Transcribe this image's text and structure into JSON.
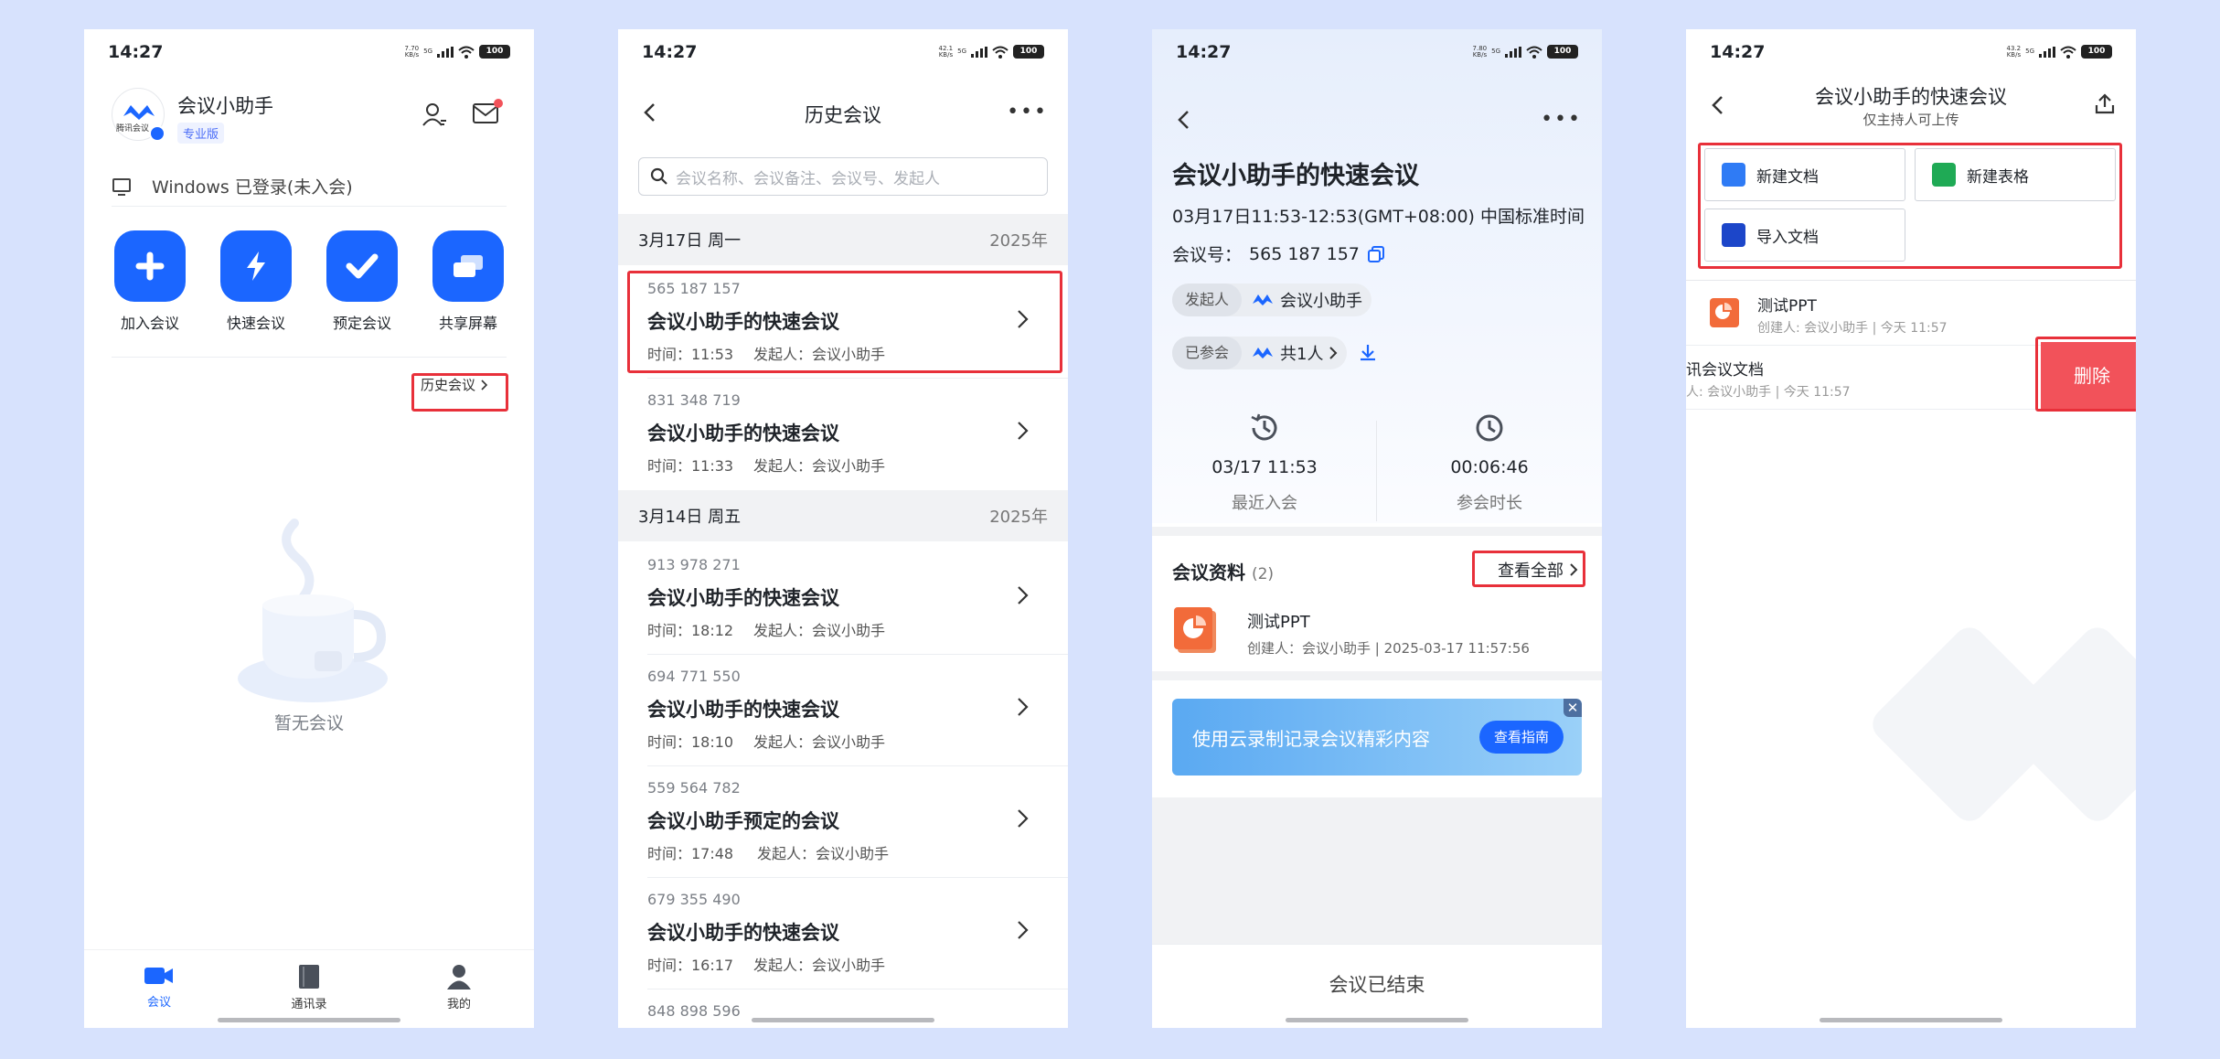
{
  "status": {
    "time": "14:27",
    "battery": "100",
    "net_speeds": [
      "7.70\nKB/s",
      "42.1\nKB/s",
      "7.80\nKB/s",
      "43.2\nKB/s"
    ],
    "net": "5G"
  },
  "home": {
    "app_name": "会议小助手",
    "badge": "专业版",
    "logo_text": "腾讯会议",
    "windows_status": "Windows 已登录(未入会)",
    "actions": [
      {
        "label": "加入会议",
        "icon": "plus-icon"
      },
      {
        "label": "快速会议",
        "icon": "bolt-icon"
      },
      {
        "label": "预定会议",
        "icon": "check-icon"
      },
      {
        "label": "共享屏幕",
        "icon": "screen-share-icon"
      }
    ],
    "history_button": "历史会议",
    "empty_text": "暂无会议",
    "tabs": [
      {
        "label": "会议",
        "icon": "video-icon",
        "active": true
      },
      {
        "label": "通讯录",
        "icon": "book-icon",
        "active": false
      },
      {
        "label": "我的",
        "icon": "person-icon",
        "active": false
      }
    ]
  },
  "history": {
    "title": "历史会议",
    "search_placeholder": "会议名称、会议备注、会议号、发起人",
    "groups": [
      {
        "date": "3月17日 周一",
        "year": "2025年",
        "items": [
          {
            "id": "565 187 157",
            "name": "会议小助手的快速会议",
            "time": "时间：11:53",
            "host": "发起人：会议小助手"
          },
          {
            "id": "831 348 719",
            "name": "会议小助手的快速会议",
            "time": "时间：11:33",
            "host": "发起人：会议小助手"
          }
        ]
      },
      {
        "date": "3月14日 周五",
        "year": "2025年",
        "items": [
          {
            "id": "913 978 271",
            "name": "会议小助手的快速会议",
            "time": "时间：18:12",
            "host": "发起人：会议小助手"
          },
          {
            "id": "694 771 550",
            "name": "会议小助手的快速会议",
            "time": "时间：18:10",
            "host": "发起人：会议小助手"
          },
          {
            "id": "559 564 782",
            "name": "会议小助手预定的会议",
            "time": "时间：17:48",
            "host": "发起人：会议小助手"
          },
          {
            "id": "679 355 490",
            "name": "会议小助手的快速会议",
            "time": "时间：16:17",
            "host": "发起人：会议小助手"
          },
          {
            "id": "848 898 596",
            "name": "",
            "time": "",
            "host": ""
          }
        ]
      }
    ]
  },
  "detail": {
    "title": "会议小助手的快速会议",
    "time": "03月17日11:53-12:53(GMT+08:00) 中国标准时间…",
    "meeting_id_label": "会议号：",
    "meeting_id": "565 187 157",
    "host_label": "发起人",
    "host_name": "会议小助手",
    "joined_label": "已参会",
    "joined_value": "共1人",
    "stats": [
      {
        "value": "03/17 11:53",
        "caption": "最近入会",
        "icon": "history-clock-icon"
      },
      {
        "value": "00:06:46",
        "caption": "参会时长",
        "icon": "clock-icon"
      }
    ],
    "materials_title": "会议资料",
    "materials_count": "(2)",
    "see_all": "查看全部",
    "file_name": "测试PPT",
    "file_meta": "创建人：会议小助手 | 2025-03-17 11:57:56",
    "banner_text": "使用云录制记录会议精彩内容",
    "banner_button": "查看指南",
    "banner_close": "✕",
    "ended": "会议已结束"
  },
  "docs": {
    "title": "会议小助手的快速会议",
    "subtitle": "仅主持人可上传",
    "buttons": [
      {
        "label": "新建文档",
        "color": "#2f7bf5"
      },
      {
        "label": "新建表格",
        "color": "#1faa55"
      },
      {
        "label": "导入文档",
        "color": "#1c46c9"
      }
    ],
    "files": [
      {
        "name": "测试PPT",
        "creator": "创建人: 会议小助手",
        "time": "今天 11:57"
      },
      {
        "name": "讯会议文档",
        "creator": "人: 会议小助手",
        "time": "今天 11:57"
      }
    ],
    "delete": "删除"
  },
  "colors": {
    "accent": "#1b66ff",
    "highlight": "#e8303a",
    "page_bg": "#d7e2fd"
  }
}
